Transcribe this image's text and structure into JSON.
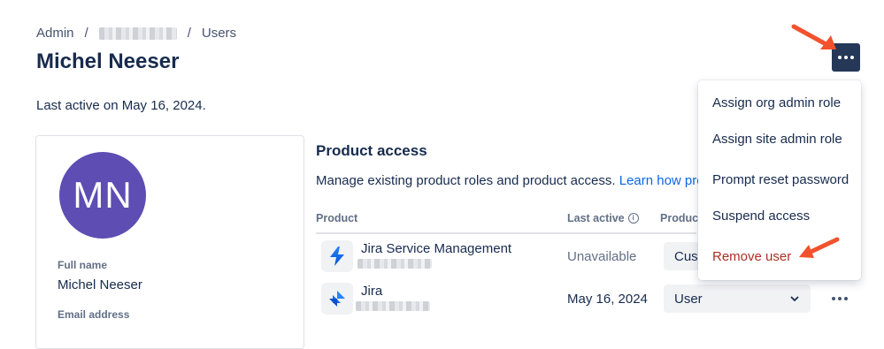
{
  "breadcrumb": {
    "root": "Admin",
    "separator": "/",
    "current": "Users"
  },
  "user": {
    "name": "Michel Neeser",
    "initials": "MN",
    "last_active": "Last active on May 16, 2024."
  },
  "profile_card": {
    "full_name_label": "Full name",
    "full_name_value": "Michel Neeser",
    "email_label": "Email address"
  },
  "product_access": {
    "title": "Product access",
    "description": "Manage existing product roles and product access.",
    "learn_link": "Learn how pro",
    "columns": {
      "product": "Product",
      "last_active": "Last active",
      "role": "Produc"
    },
    "rows": [
      {
        "name": "Jira Service Management",
        "last_active": "Unavailable",
        "role": "Cus",
        "icon": "jira-service-management-icon"
      },
      {
        "name": "Jira",
        "last_active": "May 16, 2024",
        "role": "User",
        "icon": "jira-icon"
      }
    ]
  },
  "actions_menu": {
    "items": [
      {
        "label": "Assign org admin role"
      },
      {
        "label": "Assign site admin role"
      },
      {
        "label": "Prompt reset password"
      },
      {
        "label": "Suspend access"
      },
      {
        "label": "Remove user",
        "danger": true
      }
    ]
  },
  "colors": {
    "accent": "#0c66e4",
    "avatar": "#5e4db2",
    "danger": "#ae2e24",
    "more_button": "#253858",
    "annotation_arrow": "#f2522e"
  },
  "icons": [
    "info-icon",
    "more-icon",
    "chevron-down-icon",
    "jira-service-management-icon",
    "jira-icon",
    "annotation-arrow-icon"
  ]
}
